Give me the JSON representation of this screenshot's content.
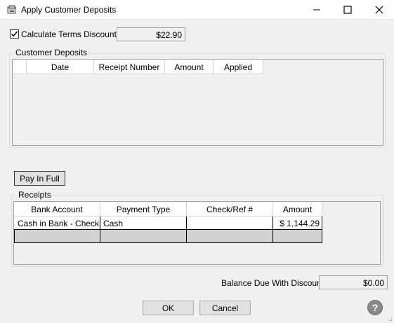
{
  "window": {
    "title": "Apply Customer Deposits",
    "icon": "app-icon",
    "controls": [
      "minimize-icon",
      "maximize-icon",
      "close-icon"
    ]
  },
  "terms": {
    "checkbox_label": "Calculate Terms Discount",
    "checked": true,
    "discount_value": "$22.90"
  },
  "deposits": {
    "group_label": "Customer Deposits",
    "columns": [
      "Date",
      "Receipt Number",
      "Amount",
      "Applied"
    ],
    "rows": []
  },
  "pay_in_full_label": "Pay In Full",
  "receipts": {
    "group_label": "Receipts",
    "columns": [
      "Bank Account",
      "Payment Type",
      "Check/Ref #",
      "Amount"
    ],
    "rows": [
      [
        "Cash in Bank - Checki",
        "Cash",
        "",
        "$ 1,144.29"
      ],
      [
        "",
        "",
        "",
        ""
      ]
    ]
  },
  "balance": {
    "label": "Balance Due With Discount",
    "value": "$0.00"
  },
  "buttons": {
    "ok": "OK",
    "cancel": "Cancel",
    "help": "?"
  }
}
